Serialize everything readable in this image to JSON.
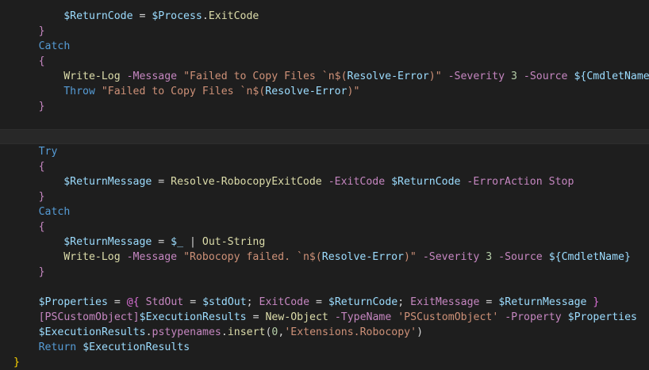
{
  "editor": {
    "language": "powershell",
    "current_line_index": 8,
    "colors": {
      "background": "#1e1e1e",
      "current_line": "#282828",
      "default": "#d4d4d4",
      "variable": "#9cdcfe",
      "keyword": "#569cd6",
      "control": "#c586c0",
      "command": "#dcdcaa",
      "parameter": "#c586c0",
      "string": "#ce9178",
      "number": "#b5cea8",
      "operator": "#d4d4d4",
      "type": "#4ec9b0",
      "brace1": "#c586c0",
      "brace2": "#da70d6",
      "brace0": "#ffd700",
      "member": "#dcdcaa",
      "interp": "#9cdcfe",
      "pipe": "#d4d4d4"
    },
    "lines": [
      {
        "indent": 8,
        "tokens": [
          {
            "t": "$ReturnCode",
            "c": "variable"
          },
          {
            "t": " = ",
            "c": "operator"
          },
          {
            "t": "$Process",
            "c": "variable"
          },
          {
            "t": ".",
            "c": "operator"
          },
          {
            "t": "ExitCode",
            "c": "command"
          }
        ]
      },
      {
        "indent": 4,
        "tokens": [
          {
            "t": "}",
            "c": "brace1"
          }
        ]
      },
      {
        "indent": 4,
        "tokens": [
          {
            "t": "Catch",
            "c": "keyword"
          }
        ]
      },
      {
        "indent": 4,
        "tokens": [
          {
            "t": "{",
            "c": "brace1"
          }
        ]
      },
      {
        "indent": 8,
        "tokens": [
          {
            "t": "Write-Log",
            "c": "command"
          },
          {
            "t": " ",
            "c": "default"
          },
          {
            "t": "-Message",
            "c": "parameter"
          },
          {
            "t": " ",
            "c": "default"
          },
          {
            "t": "\"Failed to Copy Files `n$(",
            "c": "string"
          },
          {
            "t": "Resolve-Error",
            "c": "interp"
          },
          {
            "t": ")\"",
            "c": "string"
          },
          {
            "t": " ",
            "c": "default"
          },
          {
            "t": "-Severity",
            "c": "parameter"
          },
          {
            "t": " ",
            "c": "default"
          },
          {
            "t": "3",
            "c": "number"
          },
          {
            "t": " ",
            "c": "default"
          },
          {
            "t": "-Source",
            "c": "parameter"
          },
          {
            "t": " ",
            "c": "default"
          },
          {
            "t": "${CmdletName}",
            "c": "variable"
          }
        ]
      },
      {
        "indent": 8,
        "tokens": [
          {
            "t": "Throw",
            "c": "keyword"
          },
          {
            "t": " ",
            "c": "default"
          },
          {
            "t": "\"Failed to Copy Files `n$(",
            "c": "string"
          },
          {
            "t": "Resolve-Error",
            "c": "interp"
          },
          {
            "t": ")\"",
            "c": "string"
          }
        ]
      },
      {
        "indent": 4,
        "tokens": [
          {
            "t": "}",
            "c": "brace1"
          }
        ]
      },
      {
        "indent": 0,
        "tokens": []
      },
      {
        "indent": 0,
        "tokens": []
      },
      {
        "indent": 4,
        "tokens": [
          {
            "t": "Try",
            "c": "keyword"
          }
        ]
      },
      {
        "indent": 4,
        "tokens": [
          {
            "t": "{",
            "c": "brace1"
          }
        ]
      },
      {
        "indent": 8,
        "tokens": [
          {
            "t": "$ReturnMessage",
            "c": "variable"
          },
          {
            "t": " = ",
            "c": "operator"
          },
          {
            "t": "Resolve-RobocopyExitCode",
            "c": "command"
          },
          {
            "t": " ",
            "c": "default"
          },
          {
            "t": "-ExitCode",
            "c": "parameter"
          },
          {
            "t": " ",
            "c": "default"
          },
          {
            "t": "$ReturnCode",
            "c": "variable"
          },
          {
            "t": " ",
            "c": "default"
          },
          {
            "t": "-ErrorAction",
            "c": "parameter"
          },
          {
            "t": " ",
            "c": "default"
          },
          {
            "t": "Stop",
            "c": "parameter"
          }
        ]
      },
      {
        "indent": 4,
        "tokens": [
          {
            "t": "}",
            "c": "brace1"
          }
        ]
      },
      {
        "indent": 4,
        "tokens": [
          {
            "t": "Catch",
            "c": "keyword"
          }
        ]
      },
      {
        "indent": 4,
        "tokens": [
          {
            "t": "{",
            "c": "brace1"
          }
        ]
      },
      {
        "indent": 8,
        "tokens": [
          {
            "t": "$ReturnMessage",
            "c": "variable"
          },
          {
            "t": " = ",
            "c": "operator"
          },
          {
            "t": "$_",
            "c": "variable"
          },
          {
            "t": " | ",
            "c": "pipe"
          },
          {
            "t": "Out-String",
            "c": "command"
          }
        ]
      },
      {
        "indent": 8,
        "tokens": [
          {
            "t": "Write-Log",
            "c": "command"
          },
          {
            "t": " ",
            "c": "default"
          },
          {
            "t": "-Message",
            "c": "parameter"
          },
          {
            "t": " ",
            "c": "default"
          },
          {
            "t": "\"Robocopy failed. `n$(",
            "c": "string"
          },
          {
            "t": "Resolve-Error",
            "c": "interp"
          },
          {
            "t": ")\"",
            "c": "string"
          },
          {
            "t": " ",
            "c": "default"
          },
          {
            "t": "-Severity",
            "c": "parameter"
          },
          {
            "t": " ",
            "c": "default"
          },
          {
            "t": "3",
            "c": "number"
          },
          {
            "t": " ",
            "c": "default"
          },
          {
            "t": "-Source",
            "c": "parameter"
          },
          {
            "t": " ",
            "c": "default"
          },
          {
            "t": "${CmdletName}",
            "c": "variable"
          }
        ]
      },
      {
        "indent": 4,
        "tokens": [
          {
            "t": "}",
            "c": "brace1"
          }
        ]
      },
      {
        "indent": 0,
        "tokens": []
      },
      {
        "indent": 4,
        "tokens": [
          {
            "t": "$Properties",
            "c": "variable"
          },
          {
            "t": " = ",
            "c": "operator"
          },
          {
            "t": "@{",
            "c": "brace2"
          },
          {
            "t": " ",
            "c": "default"
          },
          {
            "t": "StdOut",
            "c": "parameter"
          },
          {
            "t": " = ",
            "c": "operator"
          },
          {
            "t": "$stdOut",
            "c": "variable"
          },
          {
            "t": "; ",
            "c": "operator"
          },
          {
            "t": "ExitCode",
            "c": "parameter"
          },
          {
            "t": " = ",
            "c": "operator"
          },
          {
            "t": "$ReturnCode",
            "c": "variable"
          },
          {
            "t": "; ",
            "c": "operator"
          },
          {
            "t": "ExitMessage",
            "c": "parameter"
          },
          {
            "t": " = ",
            "c": "operator"
          },
          {
            "t": "$ReturnMessage",
            "c": "variable"
          },
          {
            "t": " ",
            "c": "default"
          },
          {
            "t": "}",
            "c": "brace2"
          }
        ]
      },
      {
        "indent": 4,
        "tokens": [
          {
            "t": "[PSCustomObject]",
            "c": "control"
          },
          {
            "t": "$ExecutionResults",
            "c": "variable"
          },
          {
            "t": " = ",
            "c": "operator"
          },
          {
            "t": "New-Object",
            "c": "command"
          },
          {
            "t": " ",
            "c": "default"
          },
          {
            "t": "-TypeName",
            "c": "parameter"
          },
          {
            "t": " ",
            "c": "default"
          },
          {
            "t": "'PSCustomObject'",
            "c": "string"
          },
          {
            "t": " ",
            "c": "default"
          },
          {
            "t": "-Property",
            "c": "parameter"
          },
          {
            "t": " ",
            "c": "default"
          },
          {
            "t": "$Properties",
            "c": "variable"
          }
        ]
      },
      {
        "indent": 4,
        "tokens": [
          {
            "t": "$ExecutionResults",
            "c": "variable"
          },
          {
            "t": ".",
            "c": "operator"
          },
          {
            "t": "pstypenames",
            "c": "parameter"
          },
          {
            "t": ".",
            "c": "operator"
          },
          {
            "t": "insert",
            "c": "command"
          },
          {
            "t": "(",
            "c": "operator"
          },
          {
            "t": "0",
            "c": "number"
          },
          {
            "t": ",",
            "c": "operator"
          },
          {
            "t": "'Extensions.Robocopy'",
            "c": "string"
          },
          {
            "t": ")",
            "c": "operator"
          }
        ]
      },
      {
        "indent": 4,
        "tokens": [
          {
            "t": "Return",
            "c": "keyword"
          },
          {
            "t": " ",
            "c": "default"
          },
          {
            "t": "$ExecutionResults",
            "c": "variable"
          }
        ]
      },
      {
        "indent": 0,
        "tokens": [
          {
            "t": "}",
            "c": "brace0"
          }
        ]
      }
    ]
  }
}
